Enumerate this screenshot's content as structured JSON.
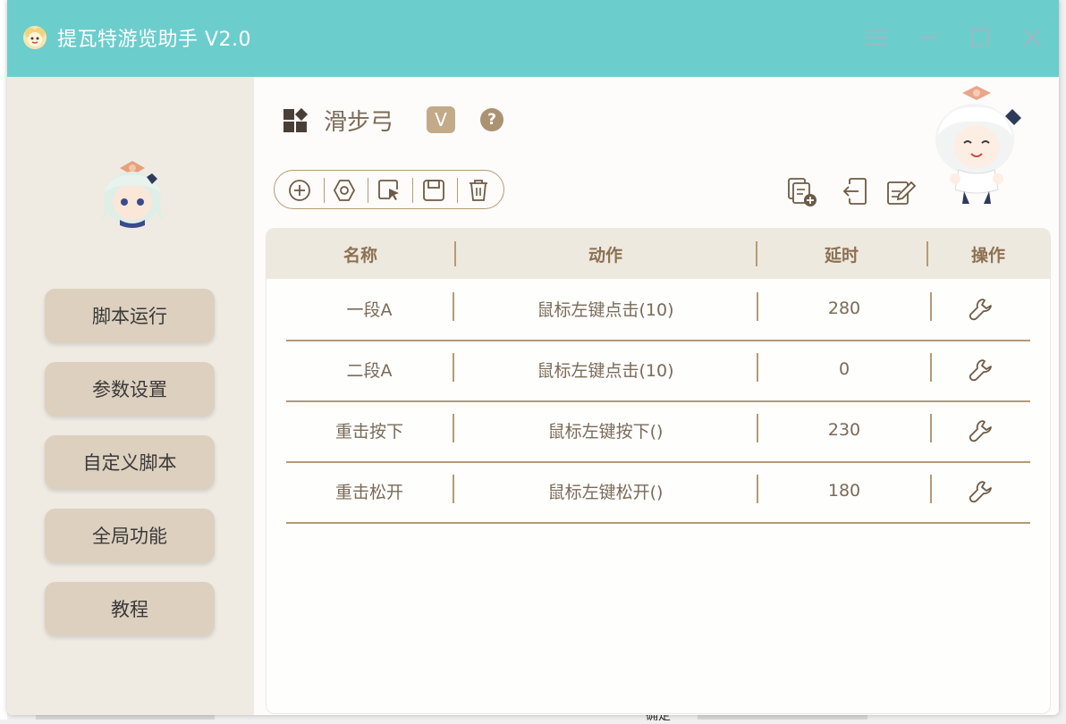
{
  "window": {
    "title": "提瓦特游览助手 V2.0",
    "accent_color": "#6ccdcd",
    "controls": [
      "menu-icon",
      "minimize-icon",
      "maximize-icon",
      "close-icon"
    ]
  },
  "sidebar": {
    "items": [
      {
        "label": "脚本运行"
      },
      {
        "label": "参数设置"
      },
      {
        "label": "自定义脚本"
      },
      {
        "label": "全局功能"
      },
      {
        "label": "教程"
      }
    ]
  },
  "script": {
    "name": "滑步弓",
    "badge": "V",
    "help": "?"
  },
  "toolbar": {
    "icons": [
      "add-icon",
      "settings-icon",
      "cursor-select-icon",
      "save-icon",
      "delete-icon"
    ],
    "right_icons": [
      "copy-add-icon",
      "import-icon",
      "edit-icon"
    ]
  },
  "table": {
    "headers": [
      "名称",
      "动作",
      "延时",
      "操作"
    ],
    "rows": [
      {
        "name": "一段A",
        "action": "鼠标左键点击(10)",
        "delay": "280"
      },
      {
        "name": "二段A",
        "action": "鼠标左键点击(10)",
        "delay": "0"
      },
      {
        "name": "重击按下",
        "action": "鼠标左键按下()",
        "delay": "230"
      },
      {
        "name": "重击松开",
        "action": "鼠标左键松开()",
        "delay": "180"
      }
    ]
  },
  "background": {
    "peek_text": "确定"
  }
}
